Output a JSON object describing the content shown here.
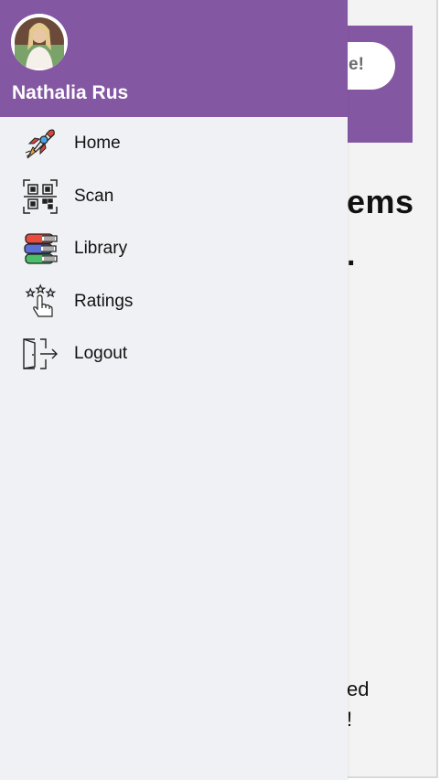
{
  "background": {
    "banner_button_text": "e!",
    "heading_text": "ems",
    "sub_text": ".",
    "footer_line1": "ed",
    "footer_line2": "!"
  },
  "drawer": {
    "user_name": "Nathalia Rus",
    "items": [
      {
        "label": "Home",
        "icon": "rocket-icon"
      },
      {
        "label": "Scan",
        "icon": "qr-code-icon"
      },
      {
        "label": "Library",
        "icon": "books-icon"
      },
      {
        "label": "Ratings",
        "icon": "tap-stars-icon"
      },
      {
        "label": "Logout",
        "icon": "logout-door-icon"
      }
    ]
  },
  "colors": {
    "header_purple": "#8457a3",
    "drawer_bg": "#f0f1f5",
    "app_bg": "#f3f3f4"
  }
}
